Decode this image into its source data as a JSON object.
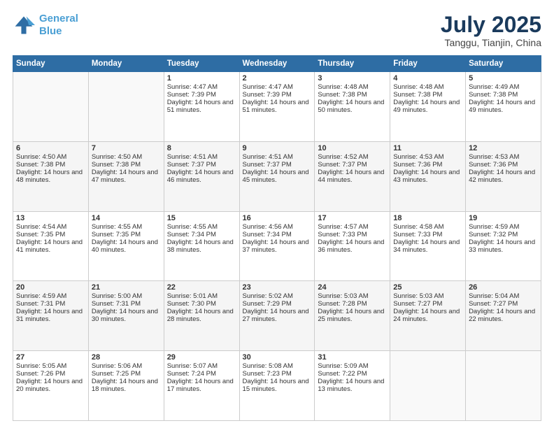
{
  "header": {
    "logo_line1": "General",
    "logo_line2": "Blue",
    "title": "July 2025",
    "subtitle": "Tanggu, Tianjin, China"
  },
  "days_header": [
    "Sunday",
    "Monday",
    "Tuesday",
    "Wednesday",
    "Thursday",
    "Friday",
    "Saturday"
  ],
  "weeks": [
    [
      {
        "day": "",
        "info": ""
      },
      {
        "day": "",
        "info": ""
      },
      {
        "day": "1",
        "info": "Sunrise: 4:47 AM\nSunset: 7:39 PM\nDaylight: 14 hours and 51 minutes."
      },
      {
        "day": "2",
        "info": "Sunrise: 4:47 AM\nSunset: 7:39 PM\nDaylight: 14 hours and 51 minutes."
      },
      {
        "day": "3",
        "info": "Sunrise: 4:48 AM\nSunset: 7:38 PM\nDaylight: 14 hours and 50 minutes."
      },
      {
        "day": "4",
        "info": "Sunrise: 4:48 AM\nSunset: 7:38 PM\nDaylight: 14 hours and 49 minutes."
      },
      {
        "day": "5",
        "info": "Sunrise: 4:49 AM\nSunset: 7:38 PM\nDaylight: 14 hours and 49 minutes."
      }
    ],
    [
      {
        "day": "6",
        "info": "Sunrise: 4:50 AM\nSunset: 7:38 PM\nDaylight: 14 hours and 48 minutes."
      },
      {
        "day": "7",
        "info": "Sunrise: 4:50 AM\nSunset: 7:38 PM\nDaylight: 14 hours and 47 minutes."
      },
      {
        "day": "8",
        "info": "Sunrise: 4:51 AM\nSunset: 7:37 PM\nDaylight: 14 hours and 46 minutes."
      },
      {
        "day": "9",
        "info": "Sunrise: 4:51 AM\nSunset: 7:37 PM\nDaylight: 14 hours and 45 minutes."
      },
      {
        "day": "10",
        "info": "Sunrise: 4:52 AM\nSunset: 7:37 PM\nDaylight: 14 hours and 44 minutes."
      },
      {
        "day": "11",
        "info": "Sunrise: 4:53 AM\nSunset: 7:36 PM\nDaylight: 14 hours and 43 minutes."
      },
      {
        "day": "12",
        "info": "Sunrise: 4:53 AM\nSunset: 7:36 PM\nDaylight: 14 hours and 42 minutes."
      }
    ],
    [
      {
        "day": "13",
        "info": "Sunrise: 4:54 AM\nSunset: 7:35 PM\nDaylight: 14 hours and 41 minutes."
      },
      {
        "day": "14",
        "info": "Sunrise: 4:55 AM\nSunset: 7:35 PM\nDaylight: 14 hours and 40 minutes."
      },
      {
        "day": "15",
        "info": "Sunrise: 4:55 AM\nSunset: 7:34 PM\nDaylight: 14 hours and 38 minutes."
      },
      {
        "day": "16",
        "info": "Sunrise: 4:56 AM\nSunset: 7:34 PM\nDaylight: 14 hours and 37 minutes."
      },
      {
        "day": "17",
        "info": "Sunrise: 4:57 AM\nSunset: 7:33 PM\nDaylight: 14 hours and 36 minutes."
      },
      {
        "day": "18",
        "info": "Sunrise: 4:58 AM\nSunset: 7:33 PM\nDaylight: 14 hours and 34 minutes."
      },
      {
        "day": "19",
        "info": "Sunrise: 4:59 AM\nSunset: 7:32 PM\nDaylight: 14 hours and 33 minutes."
      }
    ],
    [
      {
        "day": "20",
        "info": "Sunrise: 4:59 AM\nSunset: 7:31 PM\nDaylight: 14 hours and 31 minutes."
      },
      {
        "day": "21",
        "info": "Sunrise: 5:00 AM\nSunset: 7:31 PM\nDaylight: 14 hours and 30 minutes."
      },
      {
        "day": "22",
        "info": "Sunrise: 5:01 AM\nSunset: 7:30 PM\nDaylight: 14 hours and 28 minutes."
      },
      {
        "day": "23",
        "info": "Sunrise: 5:02 AM\nSunset: 7:29 PM\nDaylight: 14 hours and 27 minutes."
      },
      {
        "day": "24",
        "info": "Sunrise: 5:03 AM\nSunset: 7:28 PM\nDaylight: 14 hours and 25 minutes."
      },
      {
        "day": "25",
        "info": "Sunrise: 5:03 AM\nSunset: 7:27 PM\nDaylight: 14 hours and 24 minutes."
      },
      {
        "day": "26",
        "info": "Sunrise: 5:04 AM\nSunset: 7:27 PM\nDaylight: 14 hours and 22 minutes."
      }
    ],
    [
      {
        "day": "27",
        "info": "Sunrise: 5:05 AM\nSunset: 7:26 PM\nDaylight: 14 hours and 20 minutes."
      },
      {
        "day": "28",
        "info": "Sunrise: 5:06 AM\nSunset: 7:25 PM\nDaylight: 14 hours and 18 minutes."
      },
      {
        "day": "29",
        "info": "Sunrise: 5:07 AM\nSunset: 7:24 PM\nDaylight: 14 hours and 17 minutes."
      },
      {
        "day": "30",
        "info": "Sunrise: 5:08 AM\nSunset: 7:23 PM\nDaylight: 14 hours and 15 minutes."
      },
      {
        "day": "31",
        "info": "Sunrise: 5:09 AM\nSunset: 7:22 PM\nDaylight: 14 hours and 13 minutes."
      },
      {
        "day": "",
        "info": ""
      },
      {
        "day": "",
        "info": ""
      }
    ]
  ]
}
